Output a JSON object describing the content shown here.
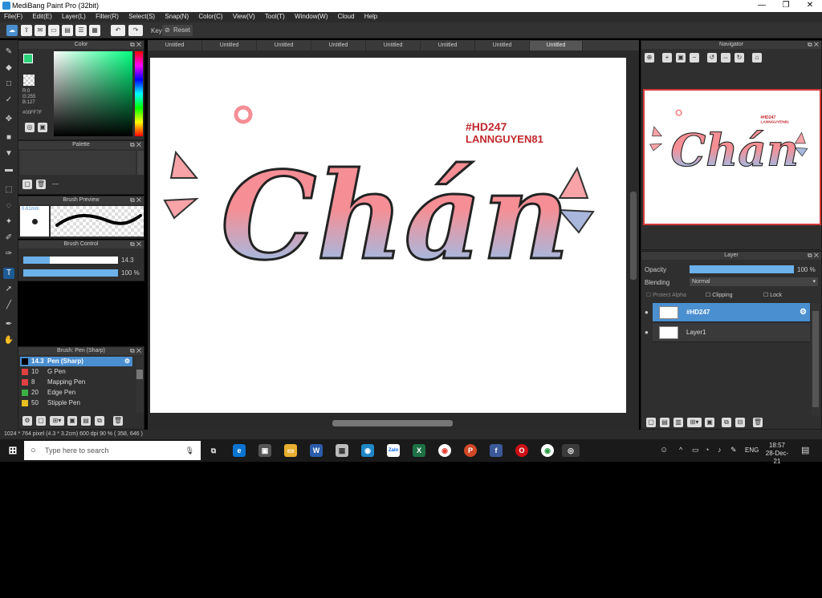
{
  "window": {
    "title": "MediBang Paint Pro (32bit)"
  },
  "menu": [
    "File(F)",
    "Edit(E)",
    "Layer(L)",
    "Filter(R)",
    "Select(S)",
    "Snap(N)",
    "Color(C)",
    "View(V)",
    "Tool(T)",
    "Window(W)",
    "Cloud",
    "Help"
  ],
  "toolbar": {
    "key_label": "Key",
    "reset_label": "Reset"
  },
  "color_panel": {
    "title": "Color",
    "r": "R:0",
    "g": "G:255",
    "b": "B:127",
    "hex": "#00FF7F",
    "fg": "#2bd37a"
  },
  "palette_panel": {
    "title": "Palette",
    "dash": "—"
  },
  "brush_preview": {
    "title": "Brush Preview",
    "size": "0.61mm"
  },
  "brush_control": {
    "title": "Brush Control",
    "size_value": "14.3",
    "opacity_value": "100 %",
    "size_fraction": 0.28,
    "opacity_fraction": 1.0
  },
  "brush_panel": {
    "title": "Brush: Pen (Sharp)",
    "items": [
      {
        "num": "14.3",
        "name": "Pen (Sharp)",
        "color": "#000000",
        "selected": true
      },
      {
        "num": "10",
        "name": "G Pen",
        "color": "#e04040"
      },
      {
        "num": "8",
        "name": "Mapping Pen",
        "color": "#e04040"
      },
      {
        "num": "20",
        "name": "Edge Pen",
        "color": "#3cb043"
      },
      {
        "num": "50",
        "name": "Stipple Pen",
        "color": "#e6c020"
      }
    ]
  },
  "tabs": [
    "Untitled",
    "Untitled",
    "Untitled",
    "Untitled",
    "Untitled",
    "Untitled",
    "Untitled",
    "Untitled"
  ],
  "canvas": {
    "main_text": "Chán",
    "credit1": "#HD247",
    "credit2": "LANNGUYEN81"
  },
  "navigator": {
    "title": "Navigator"
  },
  "layer_panel": {
    "title": "Layer",
    "opacity_label": "Opacity",
    "opacity_value": "100 %",
    "blending_label": "Blending",
    "blending_value": "Normal",
    "protect_alpha": "Protect Alpha",
    "clipping": "Clipping",
    "lock": "Lock",
    "layers": [
      {
        "name": "#HD247",
        "selected": true
      },
      {
        "name": "Layer1",
        "selected": false
      }
    ]
  },
  "status": {
    "text": "1024 * 764 pixel   (4.3 * 3.2cm)   600 dpi   90 %   ( 358, 646 )"
  },
  "taskbar": {
    "search_placeholder": "Type here to search",
    "time": "18:57",
    "date": "28-Dec-21",
    "lang": "ENG"
  }
}
